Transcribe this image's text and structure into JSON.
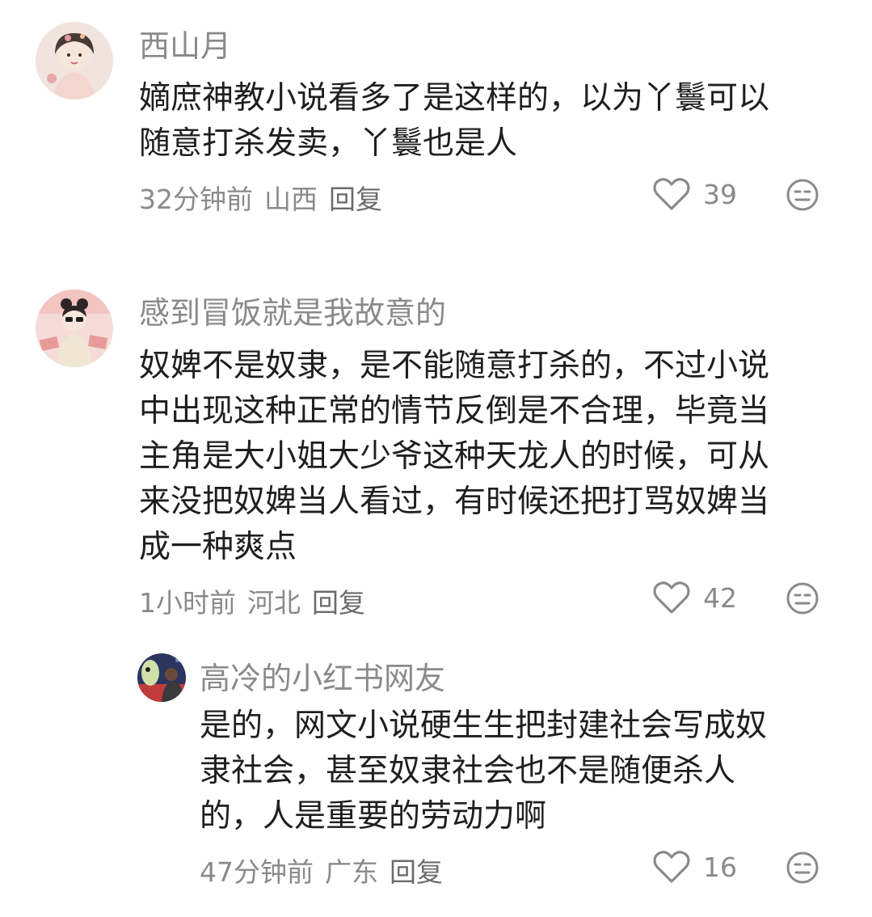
{
  "comments": [
    {
      "username": "西山月",
      "avatar_icon": "avatar-icon",
      "content_lines": [
        "嫡庶神教小说看多了是这样的，以为丫鬟可以",
        "随意打杀发卖，丫鬟也是人"
      ],
      "time": "32分钟前",
      "location": "山西",
      "reply_label": "回复",
      "likes": "39",
      "like_icon": "heart-icon",
      "dislike_icon": "dislike-face-icon"
    },
    {
      "username": "感到冒饭就是我故意的",
      "avatar_icon": "avatar-icon",
      "content_lines": [
        "奴婢不是奴隶，是不能随意打杀的，不过小说",
        "中出现这种正常的情节反倒是不合理，毕竟当",
        "主角是大小姐大少爷这种天龙人的时候，可从",
        "来没把奴婢当人看过，有时候还把打骂奴婢当",
        "成一种爽点"
      ],
      "time": "1小时前",
      "location": "河北",
      "reply_label": "回复",
      "likes": "42",
      "like_icon": "heart-icon",
      "dislike_icon": "dislike-face-icon"
    },
    {
      "username": "高冷的小红书网友",
      "avatar_icon": "avatar-icon",
      "content_lines": [
        "是的，网文小说硬生生把封建社会写成奴",
        "隶社会，甚至奴隶社会也不是随便杀人",
        "的，人是重要的劳动力啊"
      ],
      "time": "47分钟前",
      "location": "广东",
      "reply_label": "回复",
      "likes": "16",
      "like_icon": "heart-icon",
      "dislike_icon": "dislike-face-icon"
    }
  ],
  "colors": {
    "muted_text": "#8a8a8a",
    "body_text": "#1f1f1f",
    "background": "#ffffff"
  }
}
